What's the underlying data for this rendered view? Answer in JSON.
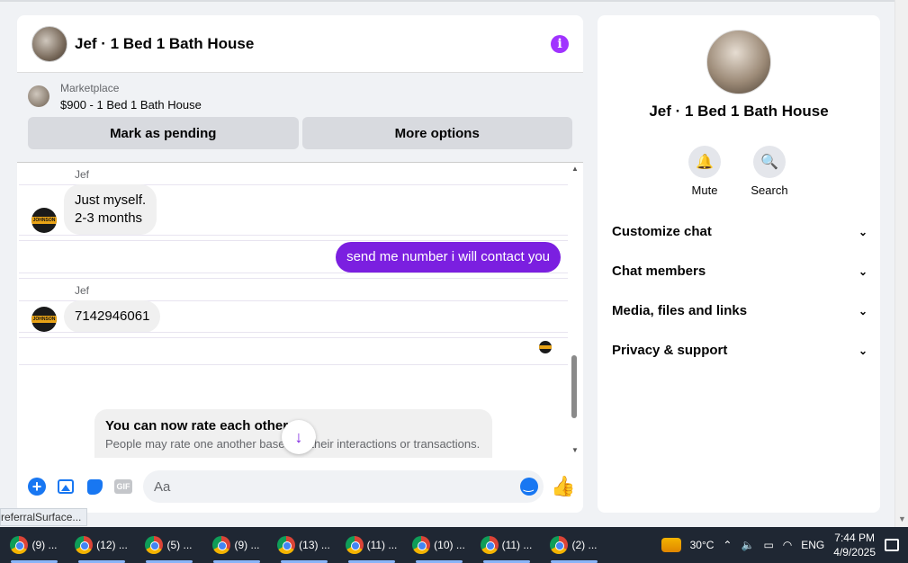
{
  "chat": {
    "title": "Jef  · 1 Bed 1 Bath House",
    "marketplace_label": "Marketplace",
    "listing": "$900 - 1 Bed 1 Bath House",
    "mark_pending": "Mark as pending",
    "more_options": "More options",
    "messages": [
      {
        "sender": "Jef",
        "line1": "Just myself.",
        "line2": "2-3 months"
      },
      {
        "outgoing": "send me number i will contact you"
      },
      {
        "sender": "Jef",
        "text": "7142946061"
      }
    ],
    "avatar_band_text": "JOHNSON",
    "rate_title": "You can now rate each other",
    "rate_sub": "People may rate one another based on their interactions or transactions.",
    "input_placeholder": "Aa",
    "gif_label": "GIF"
  },
  "side": {
    "title": "Jef  · 1 Bed 1 Bath House",
    "mute": "Mute",
    "search": "Search",
    "sections": [
      "Customize chat",
      "Chat members",
      "Media, files and links",
      "Privacy & support"
    ]
  },
  "tooltip": "referralSurface...",
  "taskbar": {
    "tasks": [
      "(9) ...",
      "(12) ...",
      "(5) ...",
      "(9) ...",
      "(13) ...",
      "(11) ...",
      "(10) ...",
      "(11) ...",
      "(2) ..."
    ],
    "temp": "30°C",
    "lang": "ENG",
    "time": "7:44 PM",
    "date": "4/9/2025"
  },
  "colors": {
    "accent": "#7b1fe0",
    "brand": "#1877f2",
    "taskbar": "#1f2733"
  }
}
